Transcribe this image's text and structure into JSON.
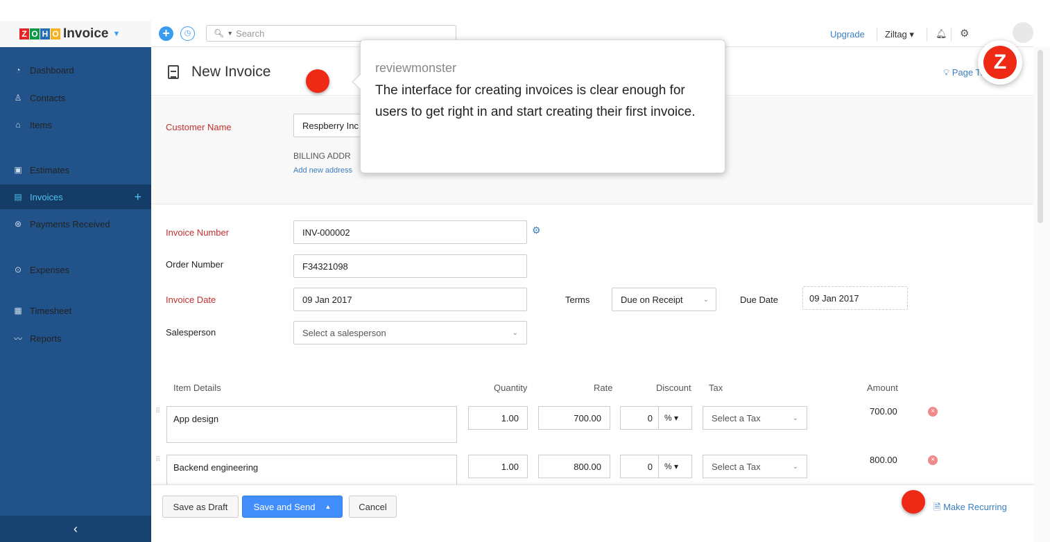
{
  "app": {
    "brand_letters": [
      "Z",
      "O",
      "H",
      "O"
    ],
    "brand_name": "Invoice",
    "search_placeholder": "Search",
    "upgrade": "Upgrade",
    "org_name": "Ziltag"
  },
  "sidebar": {
    "items": [
      {
        "label": "Dashboard",
        "icon": "dashboard-icon"
      },
      {
        "label": "Contacts",
        "icon": "contacts-icon"
      },
      {
        "label": "Items",
        "icon": "items-icon"
      },
      {
        "label": "Estimates",
        "icon": "estimates-icon"
      },
      {
        "label": "Invoices",
        "icon": "invoices-icon",
        "active": true
      },
      {
        "label": "Payments Received",
        "icon": "payments-icon"
      },
      {
        "label": "Expenses",
        "icon": "expenses-icon"
      },
      {
        "label": "Timesheet",
        "icon": "timesheet-icon"
      },
      {
        "label": "Reports",
        "icon": "reports-icon"
      }
    ],
    "collapse_glyph": "‹"
  },
  "header": {
    "title": "New Invoice",
    "page_tips": "Page Ti"
  },
  "customer": {
    "label": "Customer Name",
    "value": "Respberry Inc",
    "billing_label": "BILLING ADDR",
    "add_address": "Add new address"
  },
  "tooltip": {
    "author": "reviewmonster",
    "text": "The interface for creating invoices is clear enough for users to get right in and start creating their first invoice."
  },
  "form": {
    "invoice_number_label": "Invoice Number",
    "invoice_number": "INV-000002",
    "order_number_label": "Order Number",
    "order_number": "F34321098",
    "invoice_date_label": "Invoice Date",
    "invoice_date": "09 Jan 2017",
    "terms_label": "Terms",
    "terms_value": "Due on Receipt",
    "due_date_label": "Due Date",
    "due_date": "09 Jan 2017",
    "salesperson_label": "Salesperson",
    "salesperson_placeholder": "Select a salesperson"
  },
  "items_table": {
    "headers": {
      "item": "Item Details",
      "quantity": "Quantity",
      "rate": "Rate",
      "discount": "Discount",
      "tax": "Tax",
      "amount": "Amount"
    },
    "rows": [
      {
        "item": "App design",
        "quantity": "1.00",
        "rate": "700.00",
        "discount": "0",
        "discount_unit": "% ▾",
        "tax": "Select a Tax",
        "amount": "700.00"
      },
      {
        "item": "Backend engineering",
        "quantity": "1.00",
        "rate": "800.00",
        "discount": "0",
        "discount_unit": "% ▾",
        "tax": "Select a Tax",
        "amount": "800.00"
      }
    ]
  },
  "footer": {
    "save_draft": "Save as Draft",
    "save_send": "Save and Send",
    "cancel": "Cancel",
    "make_recurring": "Make Recurring"
  },
  "colors": {
    "sidebar": "#21538a",
    "accent": "#408dfb",
    "required_label": "#c42f2f",
    "annotation_dot": "#ee2a16"
  }
}
